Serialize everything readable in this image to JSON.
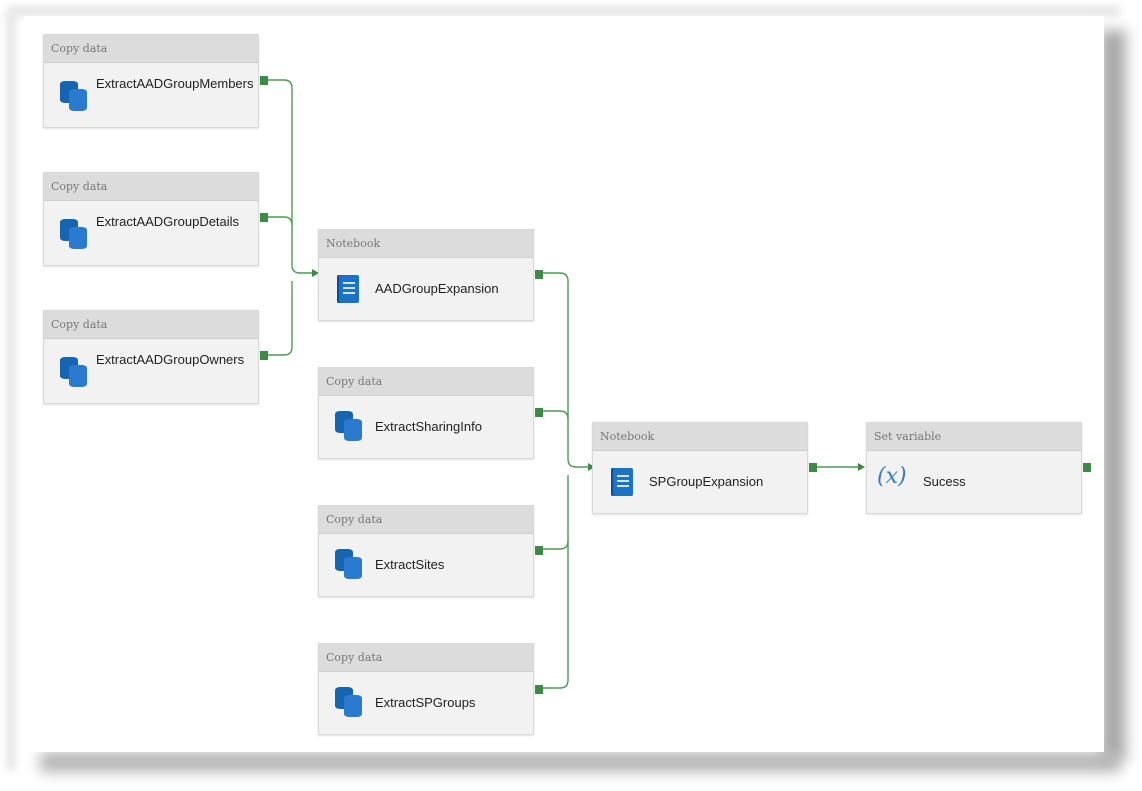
{
  "activities": [
    {
      "id": "a1",
      "type_label": "Copy data",
      "name": "ExtractAADGroupMembers",
      "icon": "database-icon"
    },
    {
      "id": "a2",
      "type_label": "Copy data",
      "name": "ExtractAADGroupDetails",
      "icon": "database-icon"
    },
    {
      "id": "a3",
      "type_label": "Copy data",
      "name": "ExtractAADGroupOwners",
      "icon": "database-icon"
    },
    {
      "id": "a4",
      "type_label": "Notebook",
      "name": "AADGroupExpansion",
      "icon": "notebook-icon"
    },
    {
      "id": "a5",
      "type_label": "Copy data",
      "name": "ExtractSharingInfo",
      "icon": "database-icon"
    },
    {
      "id": "a6",
      "type_label": "Copy data",
      "name": "ExtractSites",
      "icon": "database-icon"
    },
    {
      "id": "a7",
      "type_label": "Copy data",
      "name": "ExtractSPGroups",
      "icon": "database-icon"
    },
    {
      "id": "a8",
      "type_label": "Notebook",
      "name": "SPGroupExpansion",
      "icon": "notebook-icon"
    },
    {
      "id": "a9",
      "type_label": "Set variable",
      "name": "Sucess",
      "icon": "variable-icon",
      "icon_glyph": "(x)"
    }
  ],
  "colors": {
    "connector": "#3d8a45",
    "header": "#dcdcdc",
    "body": "#f2f2f2",
    "notebook": "#1a73c7",
    "database": "#1565b0"
  }
}
